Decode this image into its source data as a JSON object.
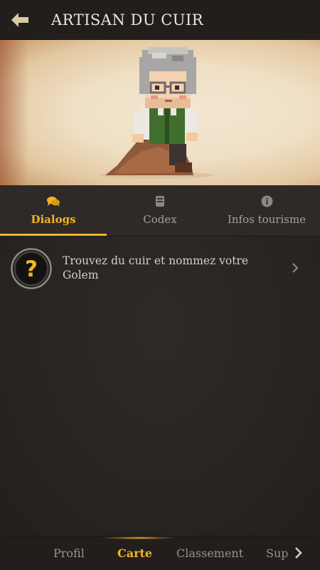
{
  "header": {
    "title": "ARTISAN DU CUIR",
    "back_icon": "back-arrow-icon"
  },
  "tabs": [
    {
      "label": "Dialogs",
      "icon": "chat-bubbles-icon",
      "active": true
    },
    {
      "label": "Codex",
      "icon": "book-icon",
      "active": false
    },
    {
      "label": "Infos tourisme",
      "icon": "info-icon",
      "active": false
    }
  ],
  "quests": [
    {
      "text": "Trouvez du cuir et nommez votre Golem",
      "icon": "question-mark-icon"
    }
  ],
  "bottom_nav": [
    {
      "label": "Profil",
      "active": false
    },
    {
      "label": "Carte",
      "active": true
    },
    {
      "label": "Classement",
      "active": false
    },
    {
      "label": "Sup",
      "active": false
    }
  ],
  "colors": {
    "accent": "#f2b624",
    "header_bg": "#221e1b",
    "content_bg": "#2b2623"
  }
}
